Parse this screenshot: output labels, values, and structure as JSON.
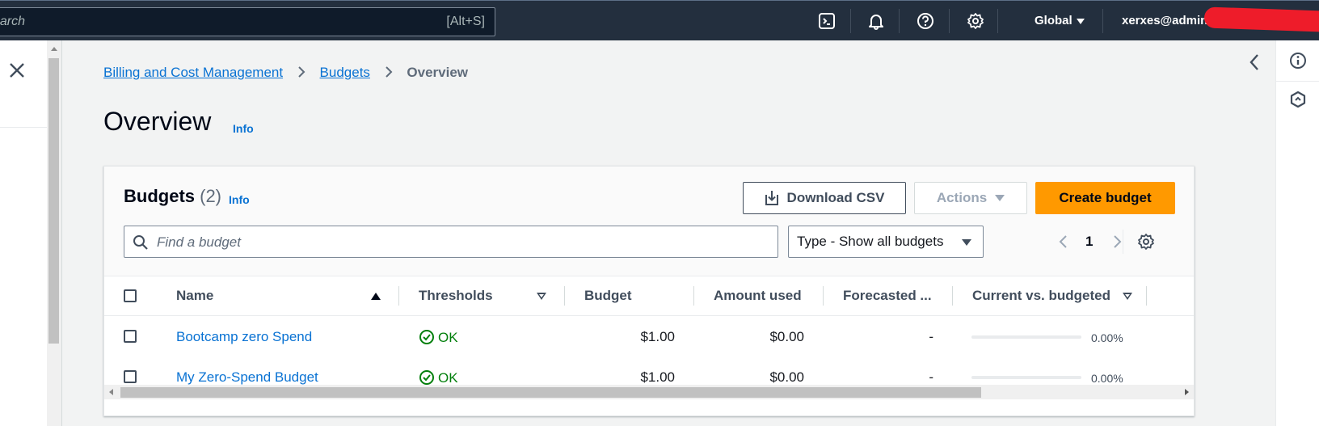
{
  "topnav": {
    "search_placeholder": "earch",
    "search_shortcut": "[Alt+S]",
    "region": "Global",
    "user": "xerxes@admin",
    "icons": [
      "cloudshell-icon",
      "bell-icon",
      "help-icon",
      "gear-icon"
    ]
  },
  "breadcrumb": {
    "items": [
      "Billing and Cost Management",
      "Budgets"
    ],
    "current": "Overview"
  },
  "page": {
    "title": "Overview",
    "info": "Info"
  },
  "budgets": {
    "title": "Budgets",
    "count": "(2)",
    "info": "Info",
    "download_label": "Download CSV",
    "actions_label": "Actions",
    "create_label": "Create budget",
    "find_placeholder": "Find a budget",
    "type_filter": "Type - Show all budgets",
    "page_number": "1",
    "columns": [
      "Name",
      "Thresholds",
      "Budget",
      "Amount used",
      "Forecasted ...",
      "Current vs. budgeted"
    ],
    "rows": [
      {
        "name": "Bootcamp zero Spend",
        "threshold": "OK",
        "budget": "$1.00",
        "amount_used": "$0.00",
        "forecasted": "-",
        "current_vs_budgeted": "0.00%",
        "progress": 0
      },
      {
        "name": "My Zero-Spend Budget",
        "threshold": "OK",
        "budget": "$1.00",
        "amount_used": "$0.00",
        "forecasted": "-",
        "current_vs_budgeted": "0.00%",
        "progress": 0
      }
    ]
  },
  "colors": {
    "nav_bg": "#232f3e",
    "link": "#0972d3",
    "primary_button": "#ff9900",
    "success": "#037f0c",
    "redaction": "#ee1c2a"
  }
}
